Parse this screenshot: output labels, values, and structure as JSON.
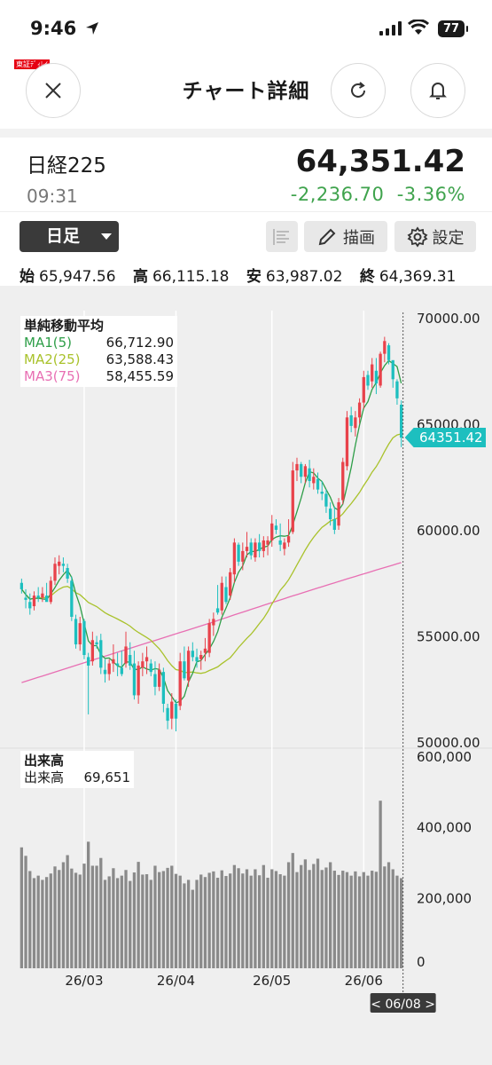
{
  "status_bar": {
    "time": "9:46",
    "battery": "77"
  },
  "brand": "東証ﾃﾞｨﾚｲ",
  "header": {
    "title": "チャート詳細"
  },
  "stock": {
    "name": "日経225",
    "time": "09:31",
    "price": "64,351.42",
    "change": "-2,236.70",
    "change_pct": "-3.36%"
  },
  "toolbar": {
    "period": "日足",
    "draw_label": "描画",
    "settings_label": "設定"
  },
  "ohlc": {
    "open_label": "始",
    "open": "65,947.56",
    "high_label": "高",
    "high": "66,115.18",
    "low_label": "安",
    "low": "63,987.02",
    "close_label": "終",
    "close": "64,369.31"
  },
  "ma_legend": {
    "title": "単純移動平均",
    "items": [
      {
        "name": "MA1(5)",
        "value": "66,712.90",
        "color": "#2e9e48"
      },
      {
        "name": "MA2(25)",
        "value": "63,588.43",
        "color": "#a9c22b"
      },
      {
        "name": "MA3(75)",
        "value": "58,455.59",
        "color": "#e86fb3"
      }
    ]
  },
  "volume_legend": {
    "title": "出来高",
    "label": "出来高",
    "value": "69,651"
  },
  "colors": {
    "up": "#e8424b",
    "down": "#1dbfbf",
    "current_price_tag": "#1dbfbf",
    "change_negative": "#3fa34d"
  },
  "chart_data": [
    {
      "type": "candlestick",
      "title": "",
      "y_ticks": [
        "70000.00",
        "65000.00",
        "60000.00",
        "55000.00",
        "50000.00"
      ],
      "ylim": [
        50000,
        70000
      ],
      "current_price_label": "64351.42",
      "x_ticks": [
        "26/03",
        "26/04",
        "26/05",
        "26/06"
      ],
      "cursor_date_label": "< 06/08 >",
      "candles": [
        [
          57500,
          57700,
          57000,
          57200
        ],
        [
          56800,
          57200,
          56300,
          56700
        ],
        [
          56600,
          57000,
          56000,
          56300
        ],
        [
          56400,
          57100,
          56200,
          56900
        ],
        [
          56900,
          57300,
          56600,
          56800
        ],
        [
          56800,
          57300,
          56600,
          57000
        ],
        [
          56900,
          57500,
          56700,
          56600
        ],
        [
          56600,
          57800,
          56500,
          57600
        ],
        [
          57600,
          58700,
          57400,
          58400
        ],
        [
          58300,
          58800,
          57900,
          58500
        ],
        [
          58400,
          58700,
          58000,
          58300
        ],
        [
          58200,
          58400,
          57500,
          57700
        ],
        [
          57600,
          57800,
          55700,
          55900
        ],
        [
          55800,
          56000,
          54400,
          54600
        ],
        [
          54600,
          55900,
          54300,
          55600
        ],
        [
          55700,
          55800,
          53900,
          54100
        ],
        [
          54000,
          54200,
          51300,
          53600
        ],
        [
          53800,
          55200,
          53600,
          54800
        ],
        [
          54700,
          55000,
          54400,
          54600
        ],
        [
          54800,
          55100,
          53200,
          53500
        ],
        [
          53400,
          53900,
          52800,
          53200
        ],
        [
          53200,
          53900,
          52900,
          53700
        ],
        [
          53700,
          54600,
          53300,
          53900
        ],
        [
          53700,
          54200,
          53100,
          53600
        ],
        [
          53500,
          54300,
          53100,
          53200
        ],
        [
          53700,
          55200,
          53500,
          54500
        ],
        [
          54100,
          54700,
          53400,
          53600
        ],
        [
          53700,
          54300,
          52000,
          52200
        ],
        [
          52200,
          53800,
          51800,
          53600
        ],
        [
          53500,
          54200,
          53100,
          53800
        ],
        [
          53800,
          54500,
          53200,
          54000
        ],
        [
          53700,
          53900,
          53100,
          53300
        ],
        [
          53200,
          53800,
          52200,
          52600
        ],
        [
          52600,
          53700,
          52400,
          53400
        ],
        [
          53300,
          53500,
          51400,
          51800
        ],
        [
          51600,
          51800,
          50600,
          51000
        ],
        [
          51100,
          52300,
          50600,
          51900
        ],
        [
          51800,
          52000,
          50500,
          51100
        ],
        [
          51700,
          54200,
          51500,
          53800
        ],
        [
          53800,
          54500,
          52900,
          53000
        ],
        [
          52900,
          54500,
          52600,
          54300
        ],
        [
          54300,
          54700,
          53800,
          54000
        ],
        [
          54000,
          54400,
          53500,
          53800
        ],
        [
          53900,
          54300,
          53400,
          54100
        ],
        [
          54200,
          54900,
          53800,
          54400
        ],
        [
          54200,
          55800,
          54000,
          55600
        ],
        [
          55500,
          56100,
          55000,
          55800
        ],
        [
          56300,
          57400,
          56000,
          56100
        ],
        [
          56200,
          57800,
          56000,
          57500
        ],
        [
          57300,
          57800,
          56500,
          56600
        ],
        [
          56900,
          58200,
          56700,
          58000
        ],
        [
          57900,
          59600,
          57500,
          59400
        ],
        [
          59300,
          59400,
          58300,
          58500
        ],
        [
          58500,
          59400,
          58100,
          59000
        ],
        [
          59000,
          59900,
          58700,
          59200
        ],
        [
          59400,
          59600,
          58600,
          58800
        ],
        [
          58700,
          59600,
          58500,
          59400
        ],
        [
          59400,
          59800,
          58700,
          59000
        ],
        [
          59000,
          59700,
          58700,
          59500
        ],
        [
          59300,
          59700,
          58800,
          59500
        ],
        [
          59500,
          60700,
          59200,
          60300
        ],
        [
          60200,
          60500,
          59800,
          60000
        ],
        [
          59500,
          60300,
          59000,
          59300
        ],
        [
          59100,
          59600,
          58800,
          59400
        ],
        [
          59400,
          60500,
          59200,
          59700
        ],
        [
          59900,
          63200,
          59800,
          62800
        ],
        [
          62800,
          63400,
          62300,
          63100
        ],
        [
          63100,
          63200,
          62200,
          62500
        ],
        [
          62500,
          63100,
          62200,
          63000
        ],
        [
          62900,
          63300,
          62000,
          62300
        ],
        [
          62200,
          62900,
          61900,
          62500
        ],
        [
          62400,
          62700,
          61700,
          61900
        ],
        [
          61800,
          62300,
          61400,
          61700
        ],
        [
          61700,
          61900,
          60800,
          61100
        ],
        [
          61000,
          61300,
          60200,
          60500
        ],
        [
          60500,
          61100,
          59800,
          60000
        ],
        [
          60200,
          61500,
          60000,
          61300
        ],
        [
          61400,
          63400,
          61200,
          63200
        ],
        [
          63000,
          65600,
          62800,
          65300
        ],
        [
          65400,
          65800,
          64600,
          64900
        ],
        [
          64800,
          65600,
          64400,
          65300
        ],
        [
          65300,
          66200,
          65000,
          66000
        ],
        [
          66000,
          67500,
          65700,
          67200
        ],
        [
          67300,
          67500,
          66600,
          66800
        ],
        [
          67000,
          68100,
          66700,
          67800
        ],
        [
          67500,
          68100,
          66400,
          66900
        ],
        [
          66800,
          68400,
          66700,
          68300
        ],
        [
          68300,
          69100,
          67900,
          68900
        ],
        [
          68700,
          68800,
          67800,
          68000
        ],
        [
          68000,
          67400,
          66700,
          67100
        ],
        [
          67000,
          67100,
          65900,
          66200
        ],
        [
          65900,
          66100,
          63900,
          64350
        ]
      ]
    },
    {
      "type": "bar",
      "title": "出来高",
      "y_ticks": [
        "600,000",
        "400,000",
        "200,000",
        "0"
      ],
      "ylim": [
        0,
        600000
      ],
      "values": [
        342000,
        318000,
        275000,
        255000,
        262000,
        250000,
        258000,
        268000,
        288000,
        278000,
        300000,
        320000,
        282000,
        270000,
        265000,
        296000,
        358000,
        290000,
        290000,
        312000,
        250000,
        260000,
        283000,
        255000,
        262000,
        278000,
        247000,
        271000,
        301000,
        265000,
        266000,
        250000,
        290000,
        272000,
        275000,
        284000,
        290000,
        267000,
        262000,
        240000,
        250000,
        222000,
        250000,
        265000,
        258000,
        270000,
        274000,
        256000,
        277000,
        261000,
        268000,
        292000,
        283000,
        268000,
        280000,
        262000,
        280000,
        263000,
        292000,
        256000,
        280000,
        275000,
        266000,
        262000,
        300000,
        326000,
        272000,
        292000,
        308000,
        278000,
        295000,
        310000,
        278000,
        285000,
        300000,
        276000,
        264000,
        276000,
        272000,
        262000,
        274000,
        260000,
        272000,
        262000,
        276000,
        273000,
        474000,
        288000,
        300000,
        280000,
        262000,
        255000
      ]
    }
  ]
}
